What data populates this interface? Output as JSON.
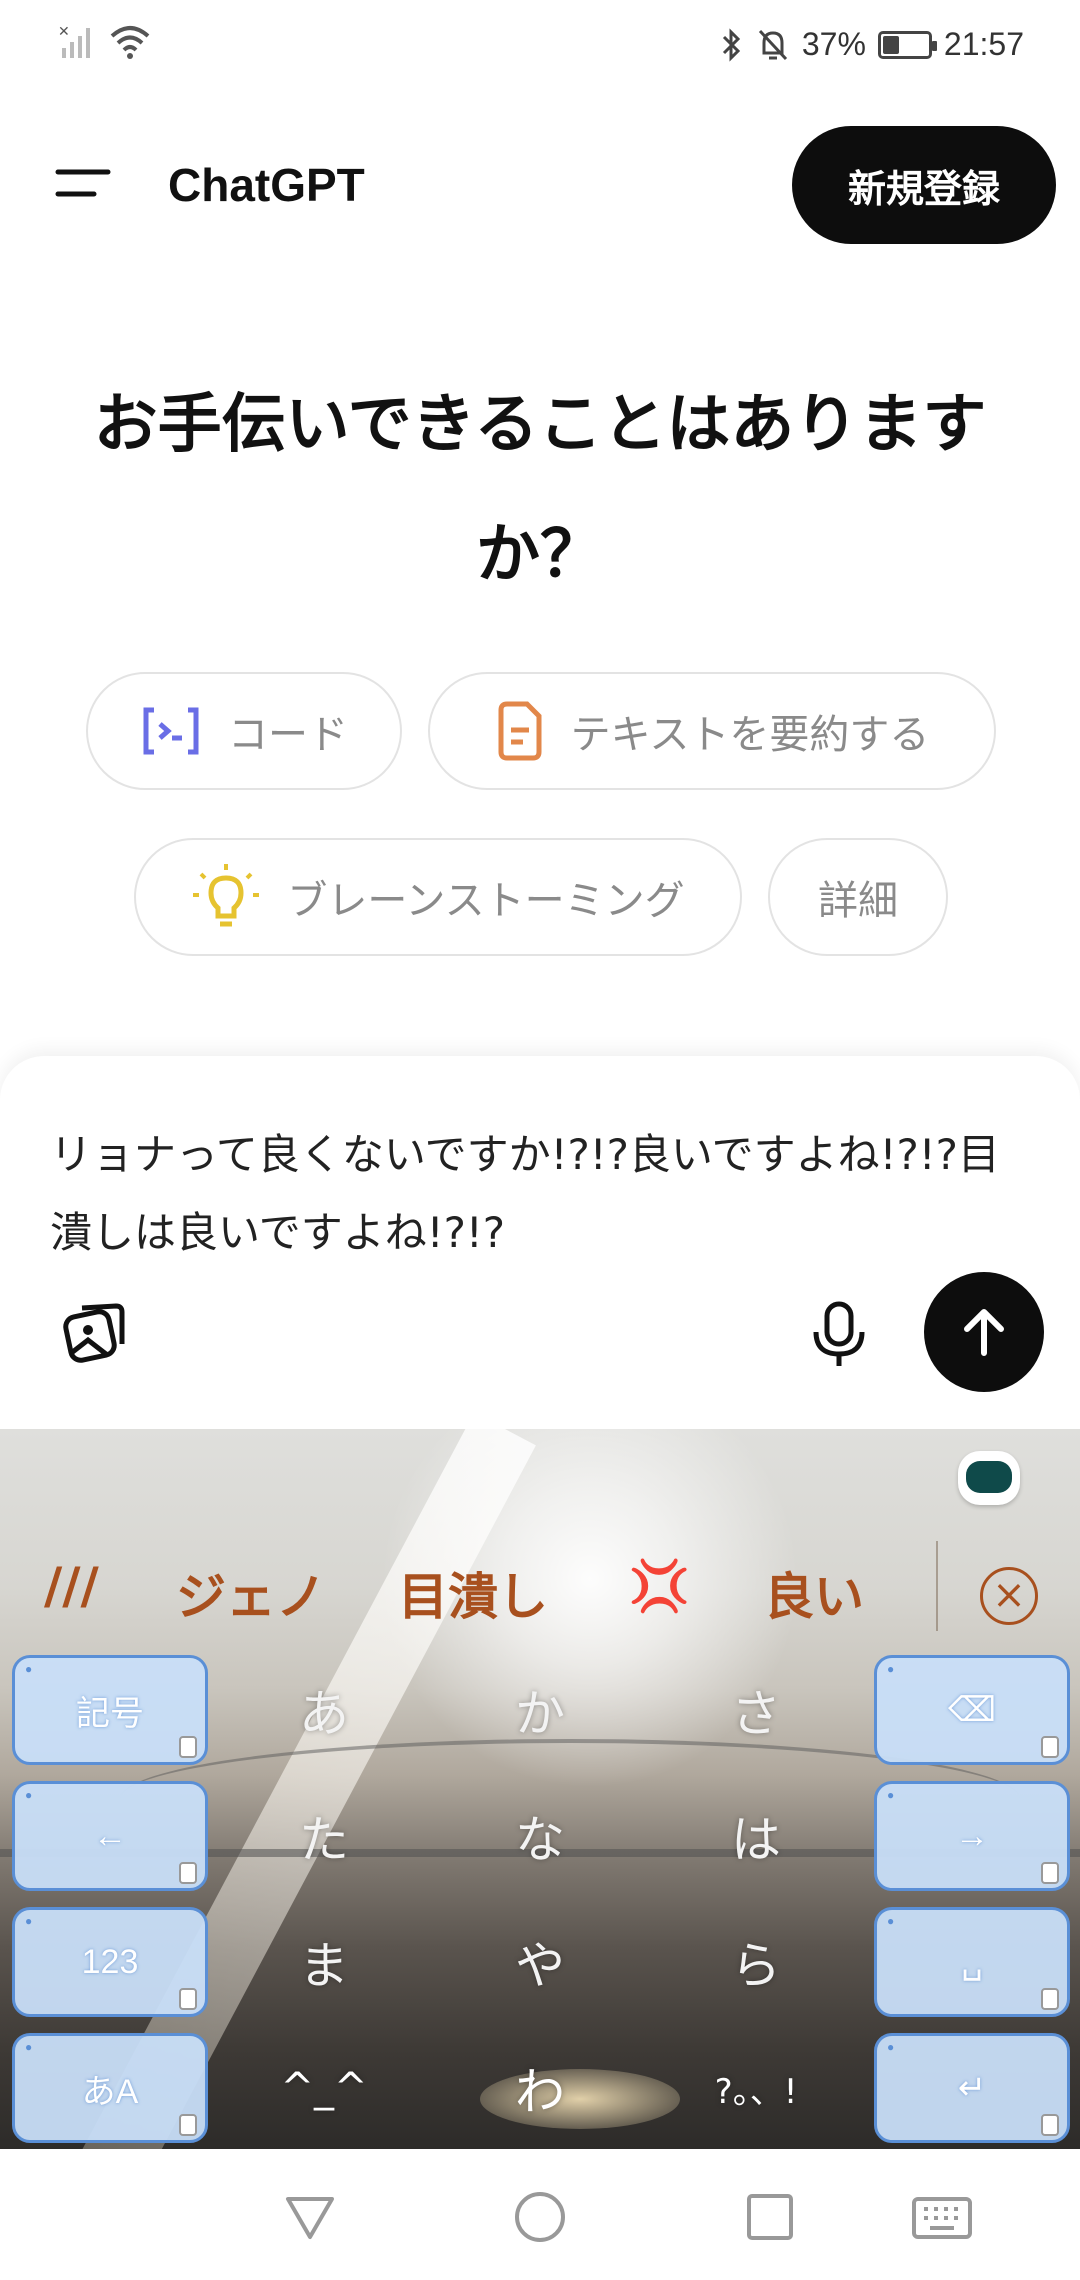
{
  "status_bar": {
    "battery_percent": "37%",
    "battery_level": 0.37,
    "time": "21:57",
    "icons": [
      "no-signal-icon",
      "wifi-icon",
      "bluetooth-icon",
      "mute-icon",
      "battery-icon"
    ]
  },
  "header": {
    "title": "ChatGPT",
    "signup_label": "新規登録"
  },
  "greeting": "お手伝いできることはありますか？",
  "suggestions": [
    {
      "label": "コード",
      "icon": "code-icon",
      "color": "#6a6ee6"
    },
    {
      "label": "テキストを要約する",
      "icon": "document-icon",
      "color": "#e2874a"
    },
    {
      "label": "ブレーンストーミング",
      "icon": "lightbulb-icon",
      "color": "#e6c330"
    },
    {
      "label": "詳細",
      "icon": ""
    }
  ],
  "composer": {
    "text": "リョナって良くないですか!?!?良いですよね!?!?目潰しは良いですよね!?!?"
  },
  "keyboard": {
    "candidates": [
      "///",
      "ジェノ",
      "目潰し",
      "💢",
      "良い"
    ],
    "left_keys": [
      "記号",
      "←",
      "123",
      "あA"
    ],
    "right_keys": [
      "⌫",
      "→",
      "␣",
      "↵"
    ],
    "kana_rows": [
      [
        "あ",
        "か",
        "さ"
      ],
      [
        "た",
        "な",
        "は"
      ],
      [
        "ま",
        "や",
        "ら"
      ],
      [
        "^_^",
        "わ",
        "?。、!"
      ]
    ],
    "accent_color": "#a8501e",
    "key_color": "#c8def8"
  },
  "nav_bar": {
    "icons": [
      "back-icon",
      "home-icon",
      "recents-icon",
      "keyboard-icon"
    ]
  }
}
